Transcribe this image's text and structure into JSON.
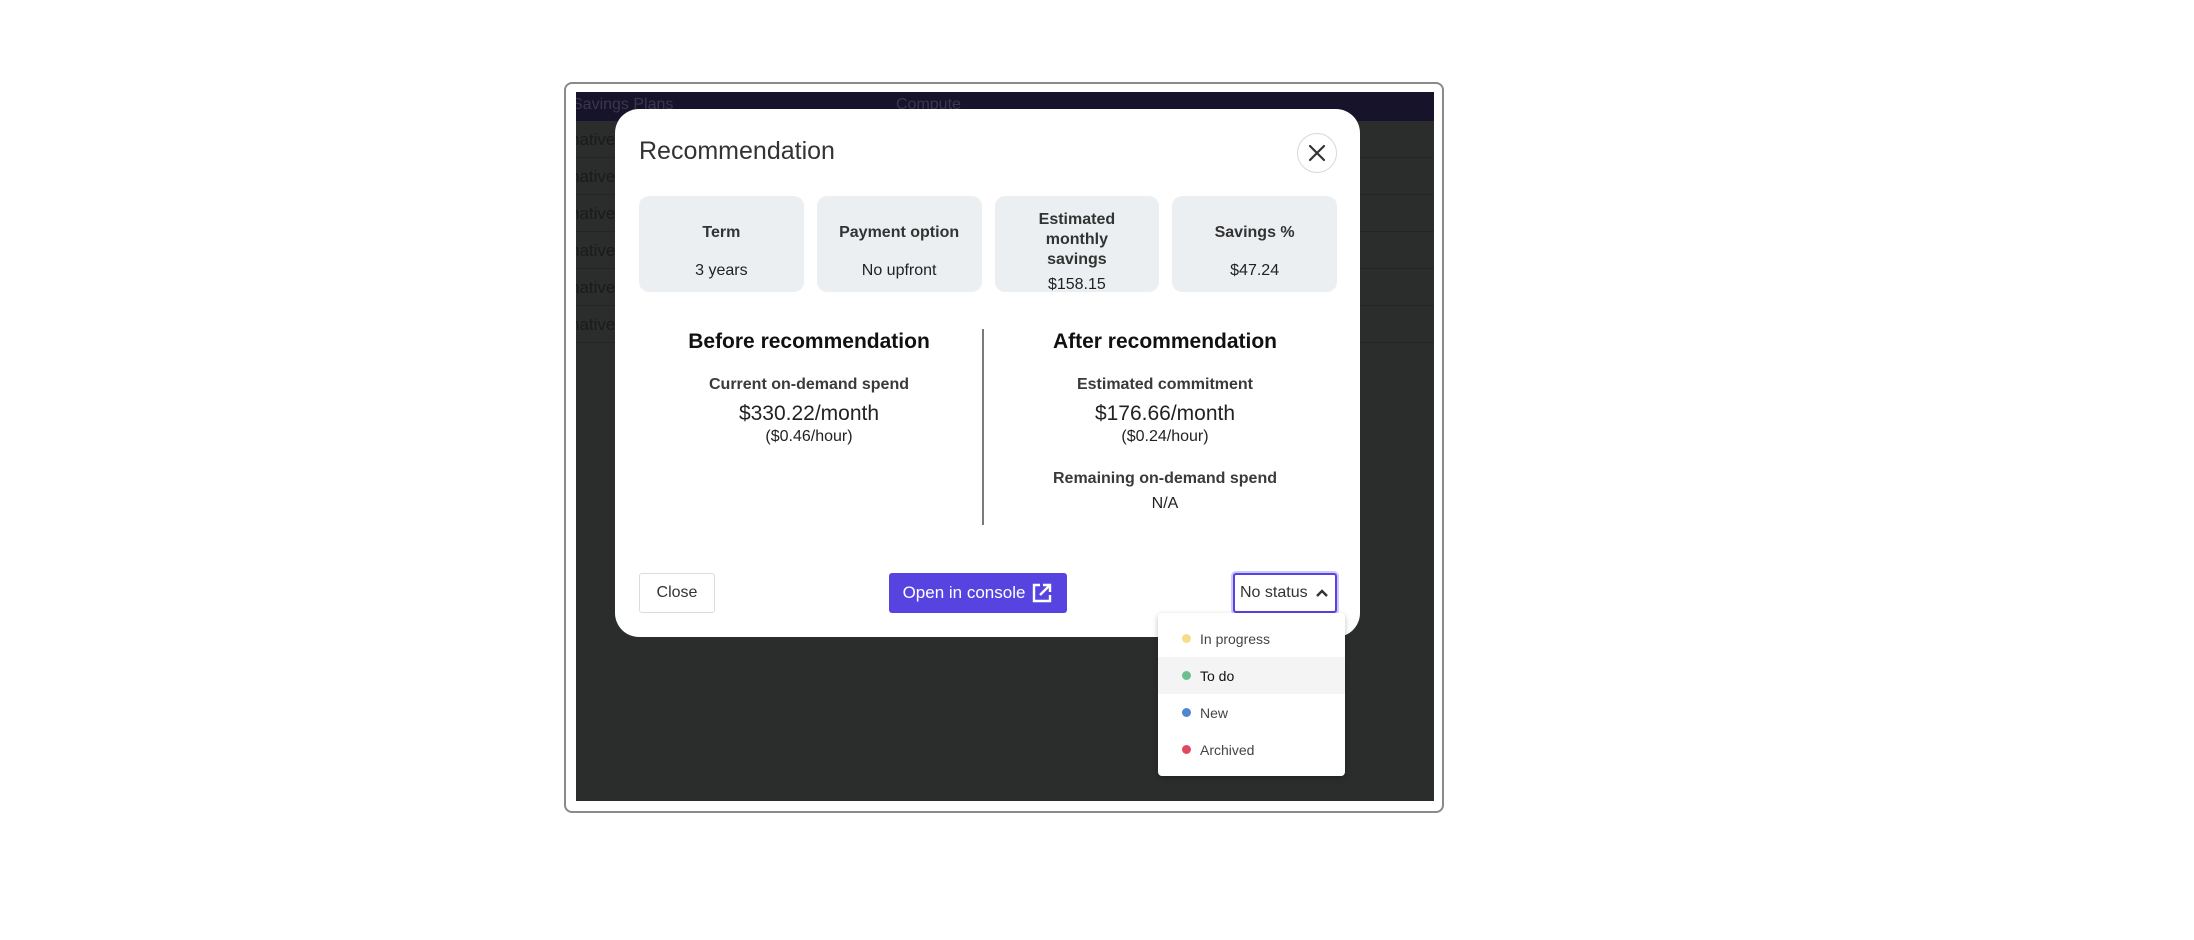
{
  "background_app": {
    "header_columns": [
      "Savings Plans",
      "Compute"
    ],
    "rows": [
      "native",
      "native",
      "native",
      "native",
      "native",
      "native"
    ]
  },
  "modal": {
    "title": "Recommendation",
    "close_icon": "close-x-icon",
    "cards": [
      {
        "label": "Term",
        "value": "3 years"
      },
      {
        "label": "Payment option",
        "value": "No upfront"
      },
      {
        "label": "Estimated monthly savings",
        "value": "$158.15"
      },
      {
        "label": "Savings %",
        "value": "$47.24"
      }
    ],
    "before": {
      "title": "Before recommendation",
      "label": "Current on-demand spend",
      "monthly": "$330.22/month",
      "hourly": "($0.46/hour)"
    },
    "after": {
      "title": "After recommendation",
      "label": "Estimated commitment",
      "monthly": "$176.66/month",
      "hourly": "($0.24/hour)",
      "remaining_label": "Remaining on-demand spend",
      "remaining_value": "N/A"
    },
    "footer": {
      "close_label": "Close",
      "console_label": "Open in console",
      "console_icon": "external-link-icon",
      "status_selected": "No status",
      "status_icon": "chevron-up-icon"
    }
  },
  "status_dropdown": {
    "options": [
      {
        "label": "In progress",
        "color": "#f7dc8b"
      },
      {
        "label": "To do",
        "color": "#6cc08e"
      },
      {
        "label": "New",
        "color": "#4f86d0"
      },
      {
        "label": "Archived",
        "color": "#e0485f"
      }
    ],
    "hovered_index": 1
  },
  "colors": {
    "accent": "#5744e0",
    "card_bg": "#eceff1",
    "overlay_bg": "#2b2d2c",
    "header_bg": "#16132a"
  }
}
